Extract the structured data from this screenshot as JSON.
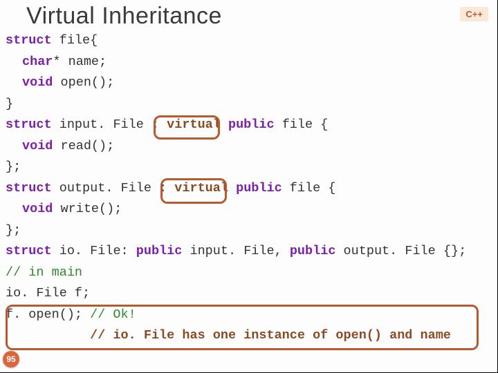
{
  "title": "Virtual Inheritance",
  "lang_badge": "C++",
  "slide_number": "95",
  "code": {
    "l1a": "struct",
    "l1b": " file{",
    "l2a": "char",
    "l2b": "* name;",
    "l3a": "void",
    "l3b": " open();",
    "l4": "}",
    "l5a": "struct",
    "l5b": " input. File : ",
    "l5c": "virtual",
    "l5d": " public",
    "l5e": " file {",
    "l6a": "void",
    "l6b": " read();",
    "l7": "};",
    "l8a": "struct",
    "l8b": " output. File : ",
    "l8c": "virtual",
    "l8d": " public",
    "l8e": " file {",
    "l9a": "void",
    "l9b": " write();",
    "l10": "};",
    "l11a": "struct",
    "l11b": " io. File: ",
    "l11c": "public",
    "l11d": " input. File, ",
    "l11e": "public",
    "l11f": " output. File {};",
    "l12": "// in main",
    "l13": "io. File f;",
    "l14a": "f. open(); ",
    "l14b": "// Ok!",
    "l15pad": "           ",
    "l15a": "// io. File has one instance of open() and name"
  }
}
